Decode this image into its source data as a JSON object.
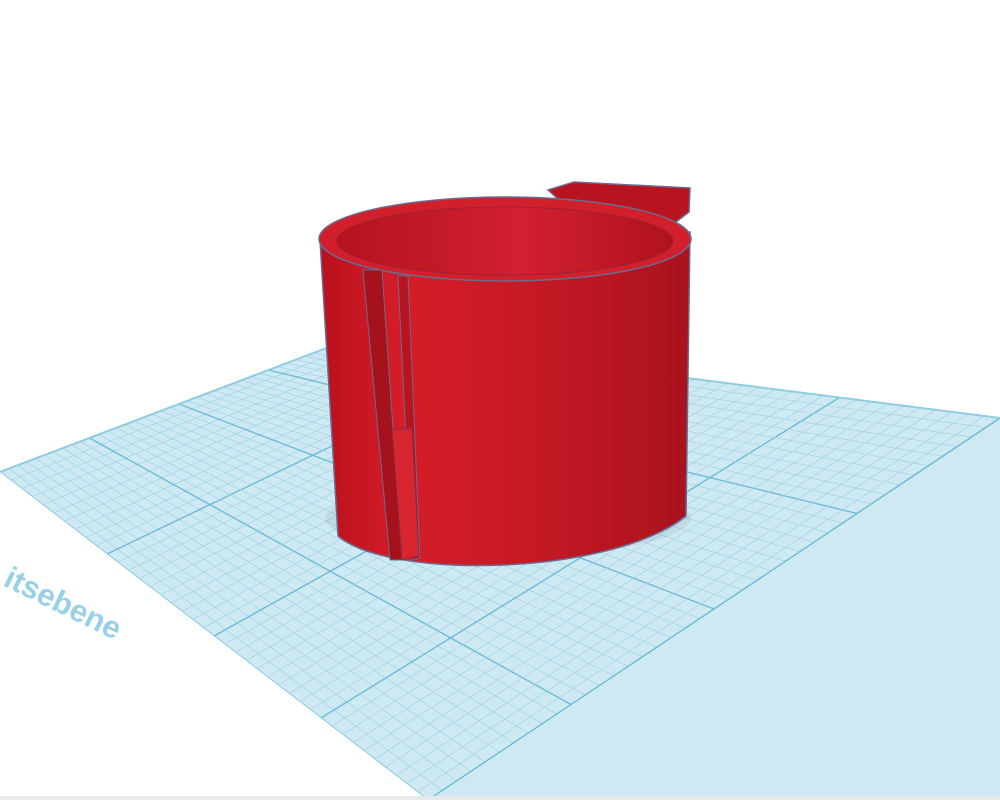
{
  "workspace": {
    "workplane_label": "Arbeitsebene",
    "visible_label_fragment": "itsebene",
    "colors": {
      "background": "#ffffff",
      "grid_fill": "#cfe9f3",
      "grid_minor": "#9fd3e6",
      "grid_major": "#69bcd9",
      "plate_edge": "#8fcde3",
      "label": "#8ccde3"
    }
  },
  "model": {
    "name": "red-cylinder-cup",
    "colors": {
      "front": "#c91a26",
      "front_dark": "#a5121c",
      "inside": "#b8141f",
      "rim": "#d7202c",
      "edge": "#6c6a8f",
      "tab": "#b9141f"
    }
  }
}
